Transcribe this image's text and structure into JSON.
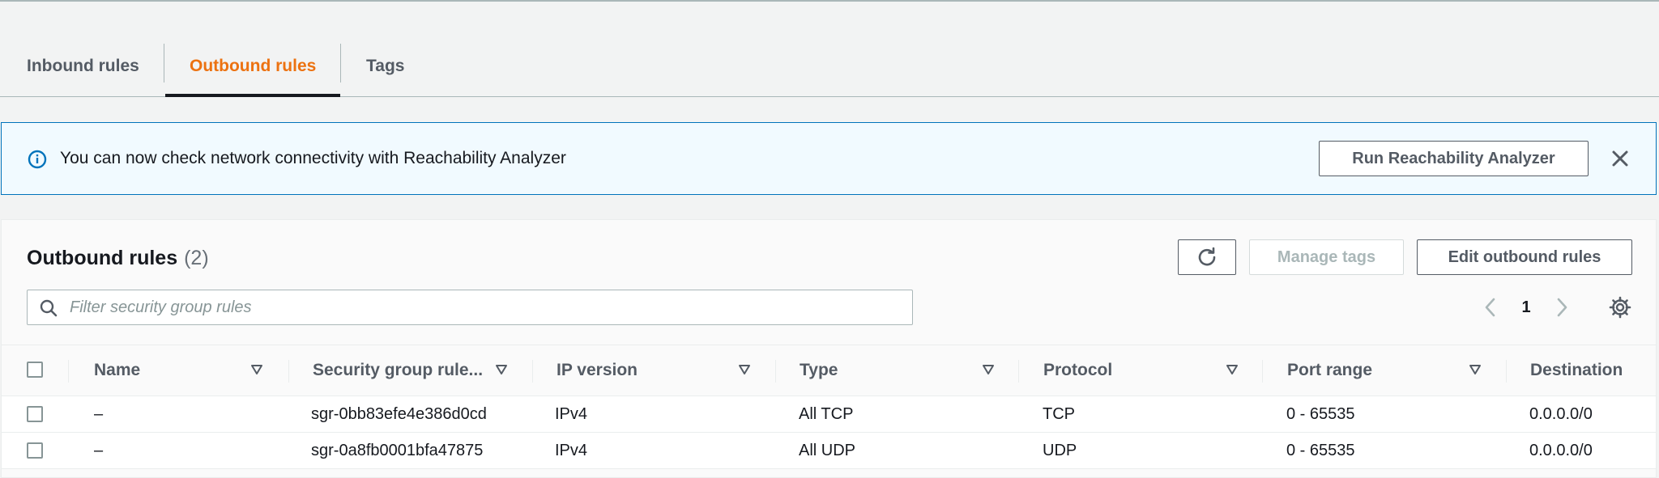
{
  "tabs": [
    {
      "label": "Inbound rules"
    },
    {
      "label": "Outbound rules",
      "active": true
    },
    {
      "label": "Tags"
    }
  ],
  "banner": {
    "text": "You can now check network connectivity with Reachability Analyzer",
    "button_label": "Run Reachability Analyzer",
    "icon": "info-icon"
  },
  "panel": {
    "title": "Outbound rules",
    "count": "(2)",
    "manage_tags_label": "Manage tags",
    "edit_label": "Edit outbound rules",
    "search_placeholder": "Filter security group rules",
    "page": "1"
  },
  "table": {
    "columns": [
      "Name",
      "Security group rule...",
      "IP version",
      "Type",
      "Protocol",
      "Port range",
      "Destination"
    ],
    "rows": [
      {
        "name": "–",
        "rule_id": "sgr-0bb83efe4e386d0cd",
        "ip_version": "IPv4",
        "type": "All TCP",
        "protocol": "TCP",
        "port_range": "0 - 65535",
        "destination": "0.0.0.0/0"
      },
      {
        "name": "–",
        "rule_id": "sgr-0a8fb0001bfa47875",
        "ip_version": "IPv4",
        "type": "All UDP",
        "protocol": "UDP",
        "port_range": "0 - 65535",
        "destination": "0.0.0.0/0"
      }
    ]
  },
  "colors": {
    "accent": "#ec7211",
    "info_blue": "#0073bb",
    "banner_bg": "#f1faff",
    "text": "#16191f",
    "muted": "#545b64"
  }
}
